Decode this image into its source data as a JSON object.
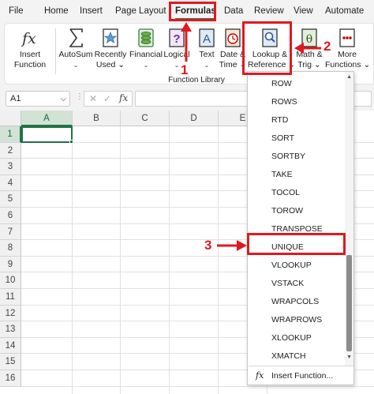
{
  "menubar": {
    "tabs": [
      "File",
      "Home",
      "Insert",
      "Page Layout",
      "Formulas",
      "Data",
      "Review",
      "View",
      "Automate"
    ],
    "active": "Formulas"
  },
  "ribbon": {
    "insert_function": {
      "line1": "Insert",
      "line2": "Function"
    },
    "autosum": {
      "line1": "AutoSum",
      "chevron": "⌄"
    },
    "recently_used": {
      "line1": "Recently",
      "line2": "Used ⌄"
    },
    "financial": {
      "line1": "Financial",
      "chevron": "⌄"
    },
    "logical": {
      "line1": "Logical",
      "chevron": "⌄"
    },
    "text": {
      "line1": "Text",
      "chevron": "⌄"
    },
    "date_time": {
      "line1": "Date &",
      "line2": "Time ⌄"
    },
    "lookup_reference": {
      "line1": "Lookup &",
      "line2": "Reference ⌄"
    },
    "math_trig": {
      "line1": "Math &",
      "line2": "Trig ⌄"
    },
    "more_functions": {
      "line1": "More",
      "line2": "Functions ⌄"
    },
    "group_label": "Function Library"
  },
  "formula_bar": {
    "name_box": "A1",
    "dots": "⋮",
    "cancel": "✕",
    "enter": "✓",
    "fx": "fx",
    "value": ""
  },
  "grid": {
    "columns": [
      "A",
      "B",
      "C",
      "D",
      "E"
    ],
    "rows": [
      "1",
      "2",
      "3",
      "4",
      "5",
      "6",
      "7",
      "8",
      "9",
      "10",
      "11",
      "12",
      "13",
      "14",
      "15",
      "16"
    ],
    "active_cell": "A1"
  },
  "dropdown": {
    "items": [
      "ROW",
      "ROWS",
      "RTD",
      "SORT",
      "SORTBY",
      "TAKE",
      "TOCOL",
      "TOROW",
      "TRANSPOSE",
      "UNIQUE",
      "VLOOKUP",
      "VSTACK",
      "WRAPCOLS",
      "WRAPROWS",
      "XLOOKUP",
      "XMATCH"
    ],
    "highlighted": "UNIQUE",
    "insert_function_icon": "fx",
    "insert_function_label": "Insert Function...",
    "scroll_up": "▲",
    "scroll_down": "▼"
  },
  "annotations": {
    "step1": "1",
    "step2": "2",
    "step3": "3",
    "color": "#e0191f"
  },
  "colors": {
    "excel_green": "#217346",
    "annotation_red": "#e0191f"
  }
}
